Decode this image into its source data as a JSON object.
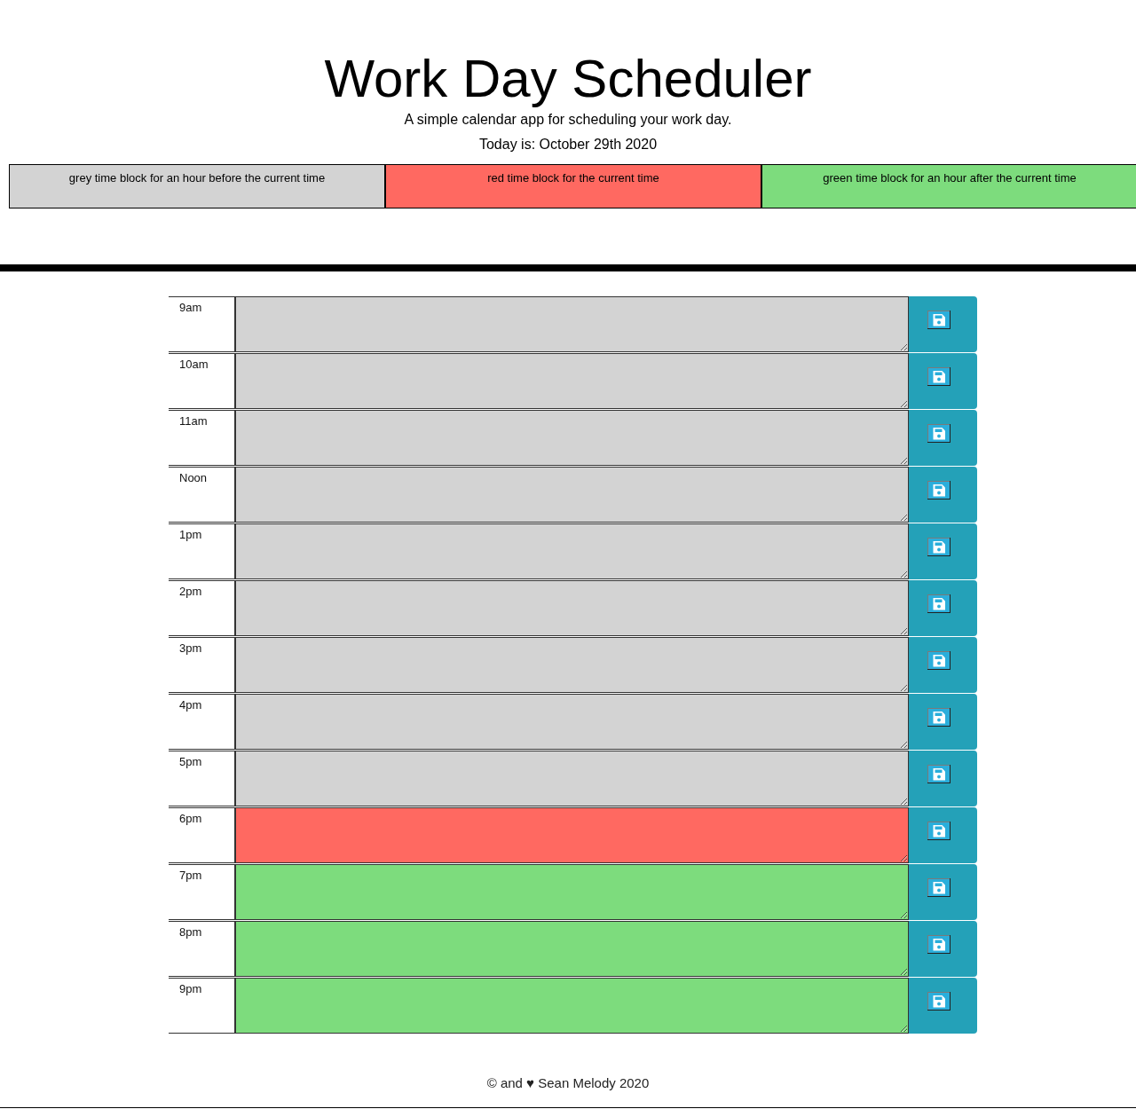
{
  "header": {
    "title": "Work Day Scheduler",
    "subtitle": "A simple calendar app for scheduling your work day.",
    "date": "Today is: October 29th 2020"
  },
  "legend": [
    {
      "label": "grey time block for an hour before the current time",
      "color": "#d3d3d3"
    },
    {
      "label": "red time block for the current time",
      "color": "#ff6961"
    },
    {
      "label": "green time block for an hour after the current time",
      "color": "#7ddc7d"
    }
  ],
  "time_blocks": [
    {
      "hour": "9am",
      "color": "#d3d3d3"
    },
    {
      "hour": "10am",
      "color": "#d3d3d3"
    },
    {
      "hour": "11am",
      "color": "#d3d3d3"
    },
    {
      "hour": "Noon",
      "color": "#d3d3d3"
    },
    {
      "hour": "1pm",
      "color": "#d3d3d3"
    },
    {
      "hour": "2pm",
      "color": "#d3d3d3"
    },
    {
      "hour": "3pm",
      "color": "#d3d3d3"
    },
    {
      "hour": "4pm",
      "color": "#d3d3d3"
    },
    {
      "hour": "5pm",
      "color": "#d3d3d3"
    },
    {
      "hour": "6pm",
      "color": "#ff6961"
    },
    {
      "hour": "7pm",
      "color": "#7ddc7d"
    },
    {
      "hour": "8pm",
      "color": "#7ddc7d"
    },
    {
      "hour": "9pm",
      "color": "#7ddc7d"
    }
  ],
  "footer": {
    "text": "© and ♥ Sean Melody 2020"
  }
}
